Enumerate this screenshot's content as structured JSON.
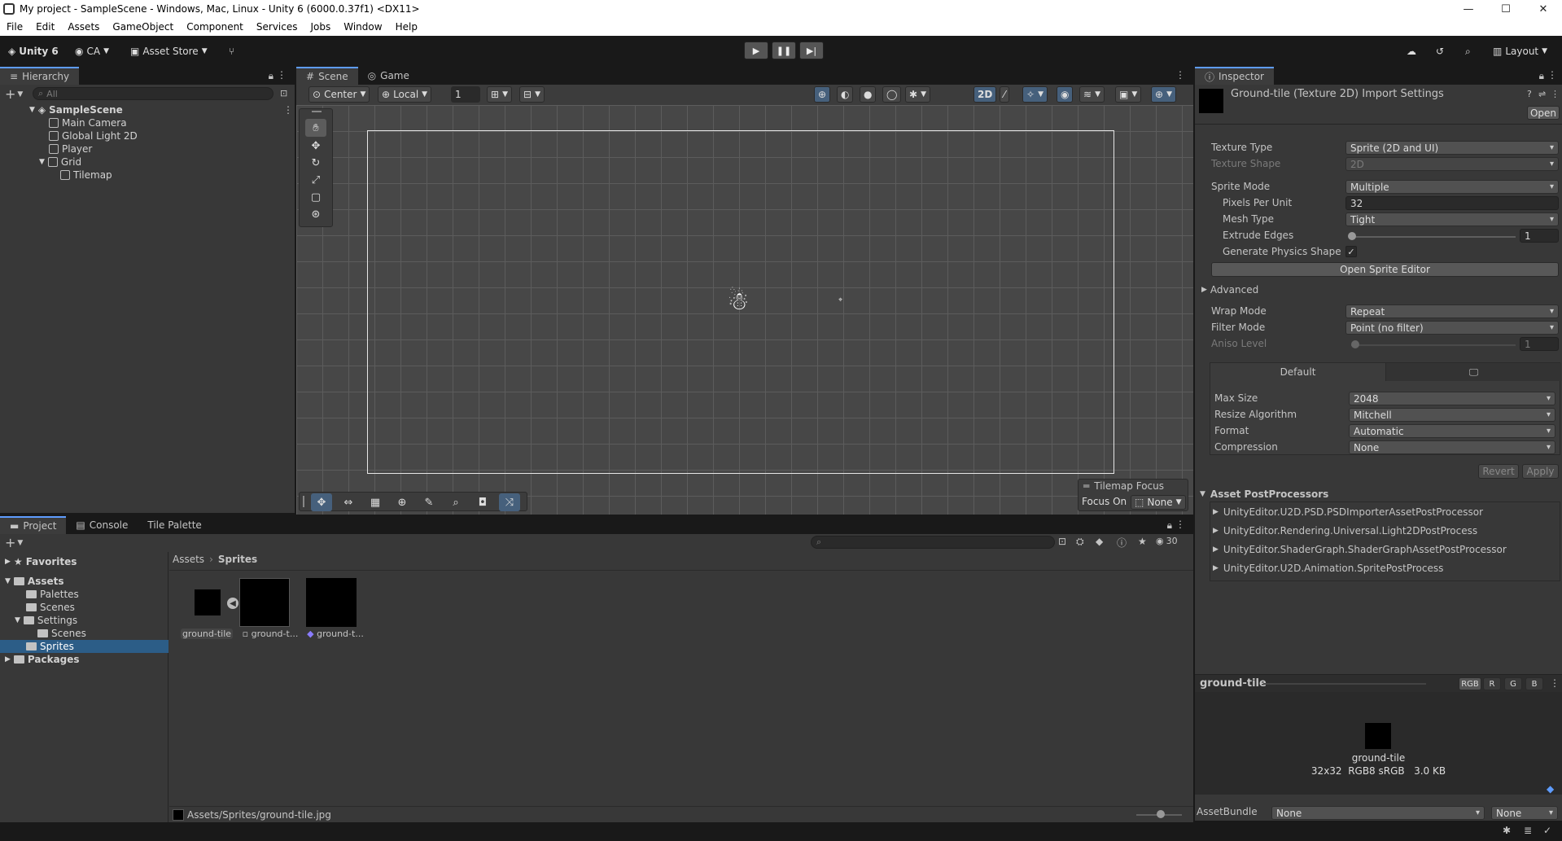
{
  "window": {
    "title": "My project - SampleScene - Windows, Mac, Linux - Unity 6 (6000.0.37f1) <DX11>",
    "minimize": "—",
    "maximize": "☐",
    "close": "✕"
  },
  "menu": [
    "File",
    "Edit",
    "Assets",
    "GameObject",
    "Component",
    "Services",
    "Jobs",
    "Window",
    "Help"
  ],
  "toolbar": {
    "unity_label": "Unity 6",
    "account": "CA",
    "asset_store": "Asset Store",
    "layout": "Layout"
  },
  "hierarchy": {
    "tab": "Hierarchy",
    "search_placeholder": "All",
    "scene": "SampleScene",
    "items": [
      "Main Camera",
      "Global Light 2D",
      "Player",
      "Grid",
      "Tilemap"
    ]
  },
  "scene": {
    "tabs": [
      "Scene",
      "Game"
    ],
    "pivot": "Center",
    "space": "Local",
    "grid_size": "1",
    "mode_2d": "2D",
    "tilemap_focus_title": "Tilemap Focus",
    "focus_on_label": "Focus On",
    "focus_on_value": "None"
  },
  "project": {
    "tabs": [
      "Project",
      "Console",
      "Tile Palette"
    ],
    "count": "30",
    "breadcrumb": [
      "Assets",
      "Sprites"
    ],
    "tree": {
      "favorites": "Favorites",
      "assets": "Assets",
      "palettes": "Palettes",
      "scenes": "Scenes",
      "settings": "Settings",
      "settings_scenes": "Scenes",
      "sprites": "Sprites",
      "packages": "Packages"
    },
    "assets": [
      "ground-tile",
      "ground-t...",
      "ground-t..."
    ],
    "status_path": "Assets/Sprites/ground-tile.jpg"
  },
  "inspector": {
    "tab": "Inspector",
    "header_title": "Ground-tile (Texture 2D) Import Settings",
    "open_button": "Open",
    "texture_type_label": "Texture Type",
    "texture_type_value": "Sprite (2D and UI)",
    "texture_shape_label": "Texture Shape",
    "texture_shape_value": "2D",
    "sprite_mode_label": "Sprite Mode",
    "sprite_mode_value": "Multiple",
    "ppu_label": "Pixels Per Unit",
    "ppu_value": "32",
    "mesh_type_label": "Mesh Type",
    "mesh_type_value": "Tight",
    "extrude_label": "Extrude Edges",
    "extrude_value": "1",
    "physics_label": "Generate Physics Shape",
    "physics_check": "✓",
    "open_sprite_editor": "Open Sprite Editor",
    "advanced": "Advanced",
    "wrap_mode_label": "Wrap Mode",
    "wrap_mode_value": "Repeat",
    "filter_mode_label": "Filter Mode",
    "filter_mode_value": "Point (no filter)",
    "aniso_label": "Aniso Level",
    "aniso_value": "1",
    "platform_default": "Default",
    "max_size_label": "Max Size",
    "max_size_value": "2048",
    "resize_label": "Resize Algorithm",
    "resize_value": "Mitchell",
    "format_label": "Format",
    "format_value": "Automatic",
    "compression_label": "Compression",
    "compression_value": "None",
    "revert": "Revert",
    "apply": "Apply",
    "postprocessors_title": "Asset PostProcessors",
    "postprocessors": [
      "UnityEditor.U2D.PSD.PSDImporterAssetPostProcessor",
      "UnityEditor.Rendering.Universal.Light2DPostProcess",
      "UnityEditor.ShaderGraph.ShaderGraphAssetPostProcessor",
      "UnityEditor.U2D.Animation.SpritePostProcess"
    ],
    "preview_name": "ground-tile",
    "channels": [
      "RGB",
      "R",
      "G",
      "B"
    ],
    "preview_caption": "ground-tile",
    "preview_info": "32x32  RGB8 sRGB   3.0 KB",
    "assetbundle_label": "AssetBundle",
    "assetbundle_value": "None",
    "assetbundle_variant": "None"
  },
  "colors": {
    "accent": "#5e9cfe",
    "selection": "#2c5d87",
    "panel": "#383838",
    "background": "#191919"
  }
}
